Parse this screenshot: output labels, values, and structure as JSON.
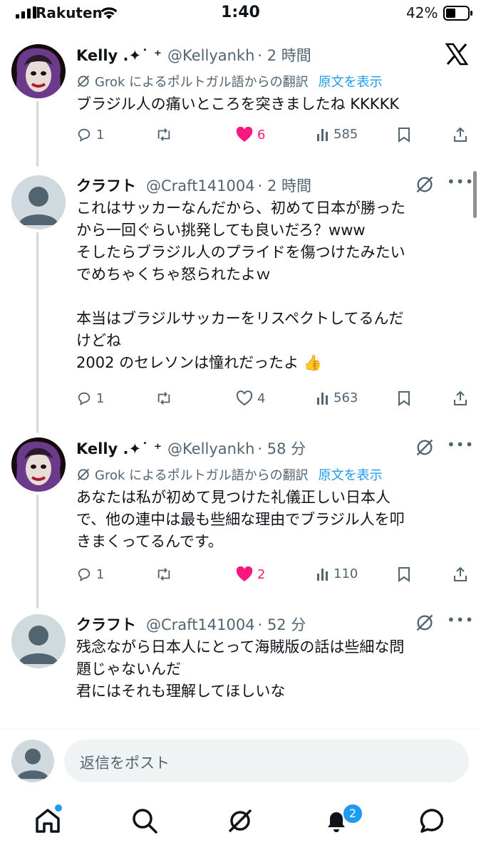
{
  "status_bar": {
    "carrier": "Rakuten",
    "time": "1:40",
    "battery": "42%"
  },
  "tweets": [
    {
      "name": "Kelly .✦˙ ⁺",
      "handle": "@Kellyankh",
      "time": "· 2 時間",
      "translation_note": "Grok によるポルトガル語からの翻訳",
      "show_original": "原文を表示",
      "lines": [
        "ブラジル人の痛いところを突きましたね KKKKK"
      ],
      "replies": "1",
      "likes": "6",
      "views": "585",
      "liked": true
    },
    {
      "name": "クラフト",
      "handle": "@Craft141004",
      "time": "· 2 時間",
      "lines": [
        "これはサッカーなんだから、初めて日本が勝った",
        "から一回ぐらい挑発しても良いだろ？www",
        "そしたらブラジル人のプライドを傷つけたみたい",
        "でめちゃくちゃ怒られたよｗ",
        "",
        "本当はブラジルサッカーをリスペクトしてるんだ",
        "けどね",
        "2002 のセレソンは憧れだったよ 👍"
      ],
      "replies": "1",
      "likes": "4",
      "views": "563",
      "liked": false
    },
    {
      "name": "Kelly .✦˙ ⁺",
      "handle": "@Kellyankh",
      "time": "· 58 分",
      "translation_note": "Grok によるポルトガル語からの翻訳",
      "show_original": "原文を表示",
      "lines": [
        "あなたは私が初めて見つけた礼儀正しい日本人",
        "で、他の連中は最も些細な理由でブラジル人を叩",
        "きまくってるんです。"
      ],
      "replies": "1",
      "likes": "2",
      "views": "110",
      "liked": true
    },
    {
      "name": "クラフト",
      "handle": "@Craft141004",
      "time": "· 52 分",
      "lines": [
        "残念ながら日本人にとって海賊版の話は些細な問",
        "題じゃないんだ",
        "君にはそれも理解してほしいな"
      ]
    }
  ],
  "reply_bar": {
    "placeholder": "返信をポスト"
  },
  "tab_bar": {
    "notification_count": "2"
  },
  "colors": {
    "accent": "#1d9bf0",
    "like": "#f91880",
    "secondary_text": "#536471"
  }
}
